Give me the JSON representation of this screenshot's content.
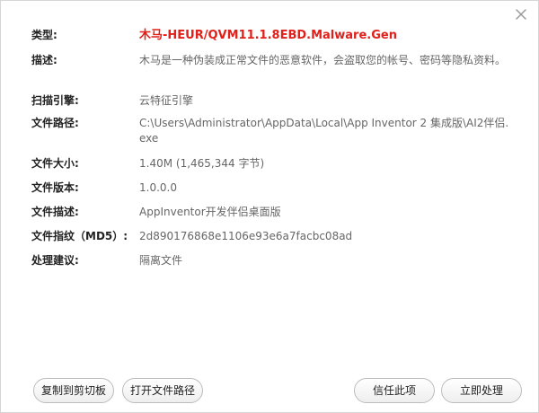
{
  "details": {
    "rows": [
      {
        "label": "类型:",
        "value": "木马-HEUR/QVM11.1.8EBD.Malware.Gen"
      },
      {
        "label": "描述:",
        "value": "木马是一种伪装成正常文件的恶意软件，会盗取您的帐号、密码等隐私资料。"
      },
      {
        "label": "扫描引擎:",
        "value": "云特征引擎"
      },
      {
        "label": "文件路径:",
        "value": "C:\\Users\\Administrator\\AppData\\Local\\App Inventor 2 集成版\\AI2伴侣.exe"
      },
      {
        "label": "文件大小:",
        "value": "1.40M (1,465,344 字节)"
      },
      {
        "label": "文件版本:",
        "value": "1.0.0.0"
      },
      {
        "label": "文件描述:",
        "value": "AppInventor开发伴侣桌面版"
      },
      {
        "label": "文件指纹（MD5）:",
        "value": "2d890176868e1106e93e6a7facbc08ad"
      },
      {
        "label": "处理建议:",
        "value": "隔离文件"
      }
    ]
  },
  "buttons": {
    "copy": "复制到剪切板",
    "open_path": "打开文件路径",
    "trust": "信任此项",
    "handle_now": "立即处理"
  },
  "colors": {
    "danger": "#e0201b",
    "label": "#222222",
    "value": "#666666"
  },
  "icons": {
    "close": "close-icon"
  }
}
